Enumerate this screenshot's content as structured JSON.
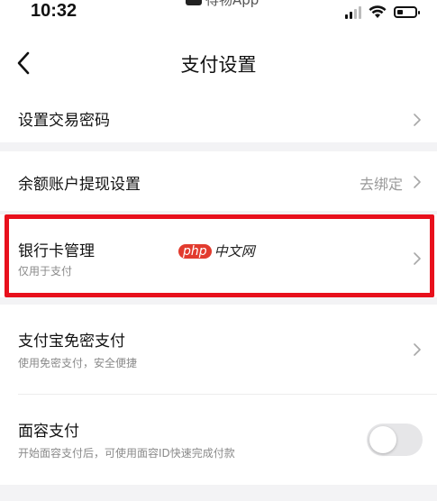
{
  "status_bar": {
    "time": "10:32",
    "center_app_name": "得物App",
    "battery_level": 0.35
  },
  "nav": {
    "title": "支付设置"
  },
  "rows": {
    "trade_password": {
      "label": "设置交易密码"
    },
    "withdraw": {
      "label": "余额账户提现设置",
      "right_text": "去绑定"
    },
    "bank_card": {
      "label": "银行卡管理",
      "sub": "仅用于支付"
    },
    "alipay": {
      "label": "支付宝免密支付",
      "sub": "使用免密支付，安全便捷"
    },
    "face_pay": {
      "label": "面容支付",
      "sub": "开始面容支付后，可使用面容ID快速完成付款",
      "enabled": false
    }
  },
  "watermark": {
    "badge": "php",
    "text": "中文网"
  },
  "colors": {
    "highlight_border": "#e8101c",
    "background": "#f3f3f5"
  }
}
